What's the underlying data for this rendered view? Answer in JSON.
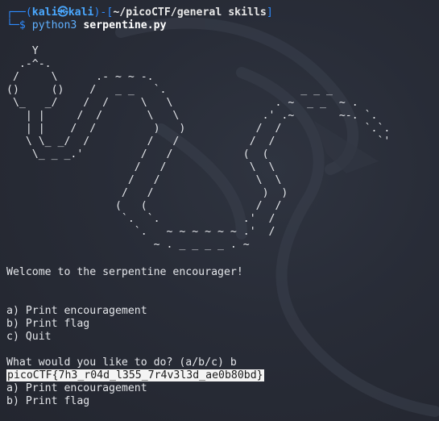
{
  "prompt": {
    "corner_top": "┌──(",
    "user": "kali㉿kali",
    "mid": ")-[",
    "path": "~/picoCTF/general skills",
    "end": "]",
    "corner_bottom": "└─",
    "symbol": "$",
    "command_bin": "python3",
    "command_arg": "serpentine.py"
  },
  "ascii_art": "    Y\n  .-^-.\n /     \\      .- ~ ~ -.\n()     ()    /   _ _   `.                     _ _ _\n \\_   _/    /  /     \\   \\                . ~  _ _  ~ .\n   | |     /  /       \\   \\             .' .~       ~-. `.\n   | |    /  /         )   )           /  /             `.`.\n   \\ \\_ _/  /         /   /           /  /                `'\n    \\_ _ _.'         /   /           (  (\n                    /   /             \\  \\\n                   /   /               \\  \\\n                  /   /                 )  )\n                 (   (                 /  /\n                  `.  `.             .'  /\n                    `.   ~ ~ ~ ~ ~ ~ .'  /\n                       ~ . _ _ _ _ . ~",
  "output": {
    "welcome": "Welcome to the serpentine encourager!",
    "menu_a": "a) Print encouragement",
    "menu_b": "b) Print flag",
    "menu_c": "c) Quit",
    "question": "What would you like to do? (a/b/c) b",
    "flag": "picoCTF{7h3_r04d_l355_7r4v3l3d_ae0b80bd}",
    "menu2_a": "a) Print encouragement",
    "menu2_b": "b) Print flag"
  },
  "colors": {
    "background": "#262a35",
    "prompt_blue": "#2e8cff",
    "text": "#e4e6ea",
    "flag_highlight": "#f4f4f4"
  }
}
